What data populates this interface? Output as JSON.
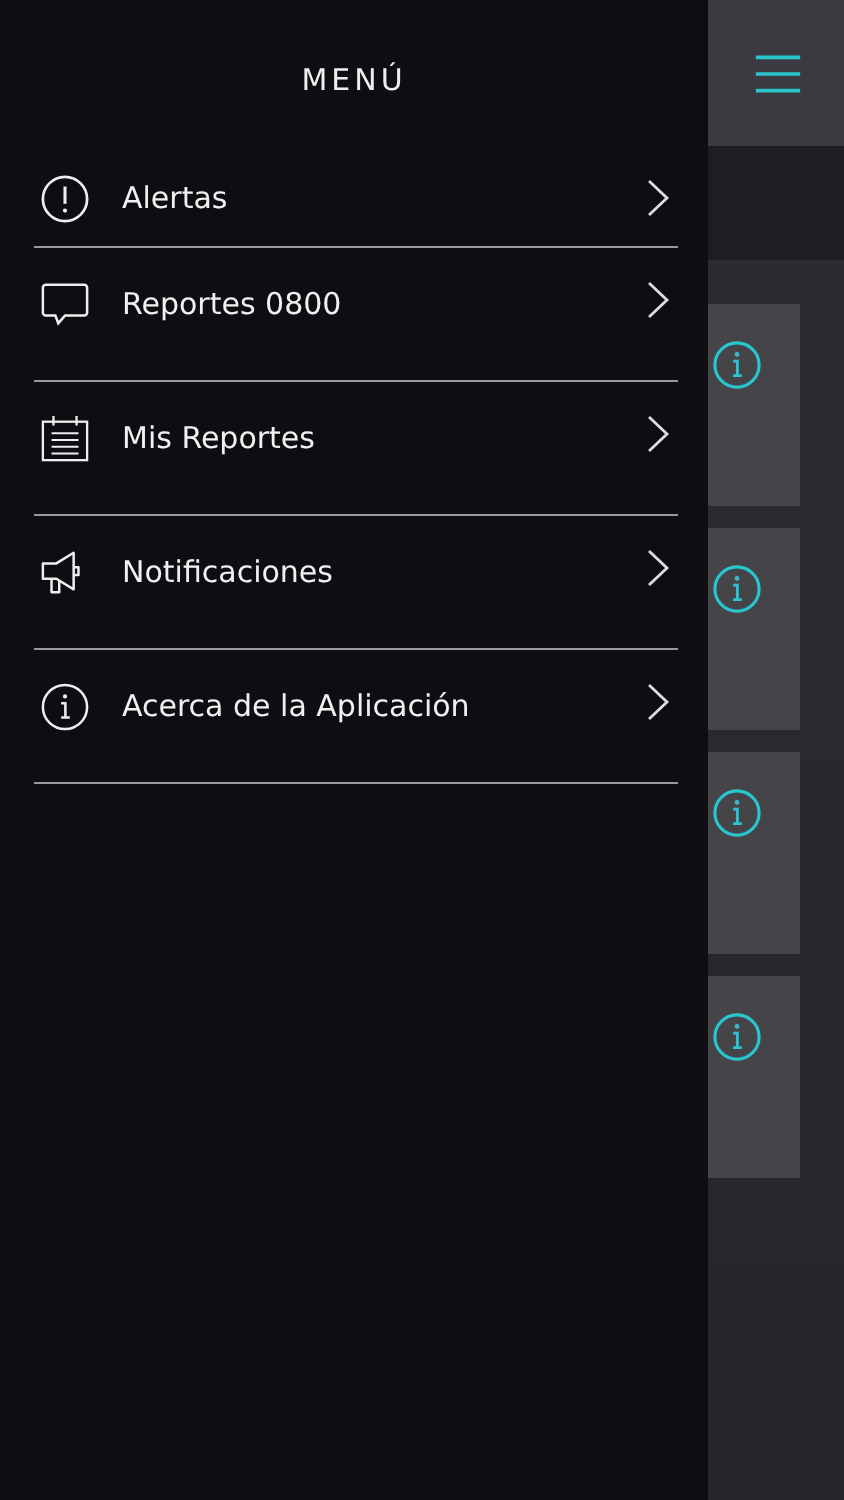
{
  "menu": {
    "title": "MENÚ",
    "items": [
      {
        "label": "Alertas",
        "kind": "alert"
      },
      {
        "label": "Reportes 0800",
        "kind": "chat"
      },
      {
        "label": "Mis Reportes",
        "kind": "calendar"
      },
      {
        "label": "Notificaciones",
        "kind": "megaphone"
      },
      {
        "label": "Acerca de la Aplicación",
        "kind": "info"
      }
    ]
  },
  "notifications": [
    {
      "kind": "info"
    },
    {
      "kind": "info"
    },
    {
      "kind": "info"
    },
    {
      "kind": "info"
    }
  ]
}
